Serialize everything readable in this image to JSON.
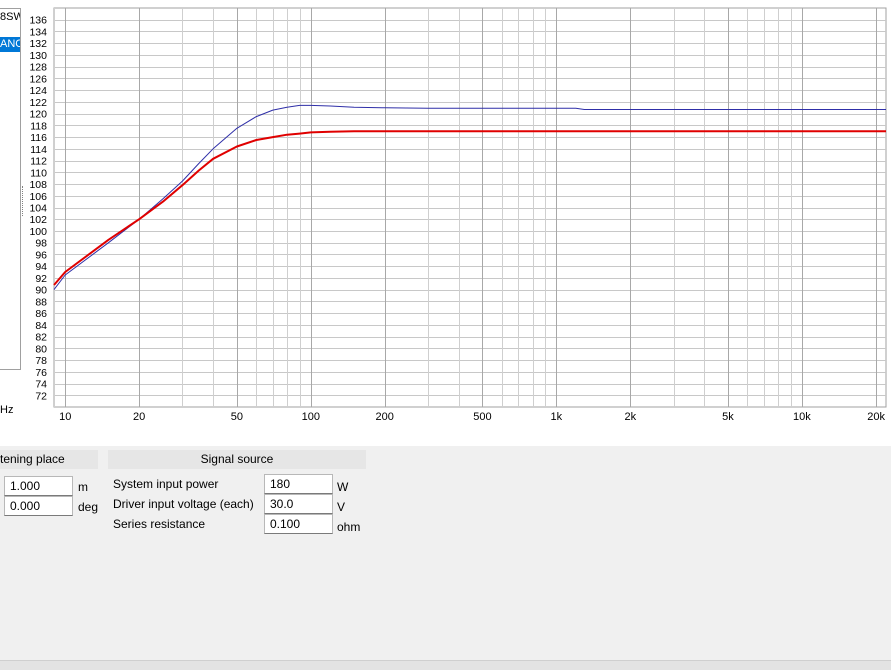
{
  "left_list": {
    "items": [
      "8SW",
      "ANC"
    ],
    "selected_index": 1
  },
  "chart_data": {
    "type": "line",
    "x_scale": "log",
    "xlim": [
      9,
      22000
    ],
    "ylim": [
      70,
      138
    ],
    "xlabel": "Hz",
    "ylabel": "",
    "title": "",
    "x_ticks": [
      10,
      20,
      50,
      100,
      200,
      500,
      1000,
      2000,
      5000,
      10000,
      20000
    ],
    "x_tick_labels": [
      "10",
      "20",
      "50",
      "100",
      "200",
      "500",
      "1k",
      "2k",
      "5k",
      "10k",
      "20k"
    ],
    "y_ticks": [
      72,
      74,
      76,
      78,
      80,
      82,
      84,
      86,
      88,
      90,
      92,
      94,
      96,
      98,
      100,
      102,
      104,
      106,
      108,
      110,
      112,
      114,
      116,
      118,
      120,
      122,
      124,
      126,
      128,
      130,
      132,
      134,
      136
    ],
    "grid": true,
    "series": [
      {
        "color": "#2f2fa8",
        "width": 1,
        "x": [
          9,
          10,
          15,
          20,
          25,
          30,
          35,
          40,
          50,
          60,
          70,
          80,
          90,
          100,
          120,
          150,
          200,
          300,
          500,
          700,
          1000,
          1200,
          1300,
          2000,
          5000,
          10000,
          20000,
          22000
        ],
        "y": [
          90,
          92.5,
          98,
          102,
          105.5,
          108.5,
          111.5,
          114,
          117.5,
          119.5,
          120.6,
          121.1,
          121.4,
          121.4,
          121.3,
          121.1,
          121,
          120.9,
          120.9,
          120.9,
          120.9,
          120.9,
          120.7,
          120.7,
          120.7,
          120.7,
          120.7,
          120.7
        ]
      },
      {
        "color": "#e00000",
        "width": 2,
        "x": [
          9,
          10,
          15,
          20,
          25,
          30,
          35,
          40,
          50,
          60,
          70,
          80,
          90,
          100,
          120,
          150,
          200,
          500,
          1000,
          5000,
          10000,
          20000,
          22000
        ],
        "y": [
          90.8,
          93,
          98.5,
          102,
          105,
          107.8,
          110.3,
          112.3,
          114.4,
          115.5,
          116,
          116.4,
          116.6,
          116.8,
          116.9,
          117,
          117,
          117,
          117,
          117,
          117,
          117,
          117
        ]
      }
    ]
  },
  "listening_place": {
    "header": "tening place",
    "fields": [
      {
        "value": "1.000",
        "unit": "m"
      },
      {
        "value": "0.000",
        "unit": "deg"
      }
    ]
  },
  "signal_source": {
    "header": "Signal source",
    "fields": [
      {
        "label": "System input power",
        "value": "180",
        "unit": "W"
      },
      {
        "label": "Driver input voltage (each)",
        "value": "30.0",
        "unit": "V"
      },
      {
        "label": "Series resistance",
        "value": "0.100",
        "unit": "ohm"
      }
    ]
  }
}
